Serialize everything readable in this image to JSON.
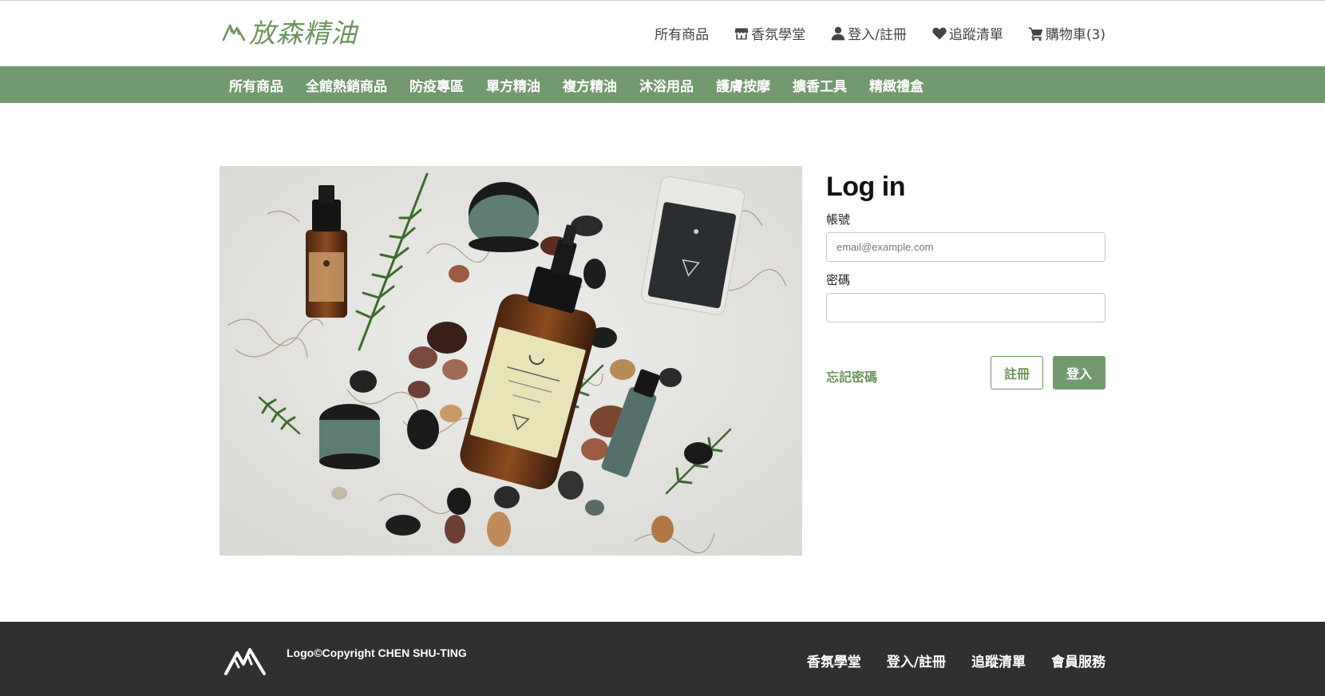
{
  "brand": {
    "logo_text": "放森精油",
    "accent": "#739a6e",
    "text_accent": "#6e9460"
  },
  "top_nav": {
    "all_products": "所有商品",
    "aroma_school": "香氛學堂",
    "login_register": "登入/註冊",
    "wishlist": "追蹤清單",
    "cart": "購物車(3)"
  },
  "category_nav": [
    {
      "label": "所有商品"
    },
    {
      "label": "全館熱銷商品"
    },
    {
      "label": "防疫專區"
    },
    {
      "label": "單方精油"
    },
    {
      "label": "複方精油"
    },
    {
      "label": "沐浴用品"
    },
    {
      "label": "護膚按摩"
    },
    {
      "label": "擴香工具"
    },
    {
      "label": "精緻禮盒"
    }
  ],
  "login": {
    "title": "Log in",
    "account_label": "帳號",
    "account_placeholder": "email@example.com",
    "account_value": "",
    "password_label": "密碼",
    "password_value": "",
    "forgot_label": "忘記密碼",
    "register_label": "註冊",
    "submit_label": "登入"
  },
  "footer": {
    "copyright": "Logo©Copyright CHEN SHU-TING",
    "links": [
      {
        "label": "香氛學堂"
      },
      {
        "label": "登入/註冊"
      },
      {
        "label": "追蹤清單"
      },
      {
        "label": "會員服務"
      }
    ],
    "background": "#303030"
  },
  "icons": {
    "logo": "mountain-logo-icon",
    "aroma_school": "shop-icon",
    "login": "user-icon",
    "wishlist": "heart-icon",
    "cart": "cart-icon"
  }
}
